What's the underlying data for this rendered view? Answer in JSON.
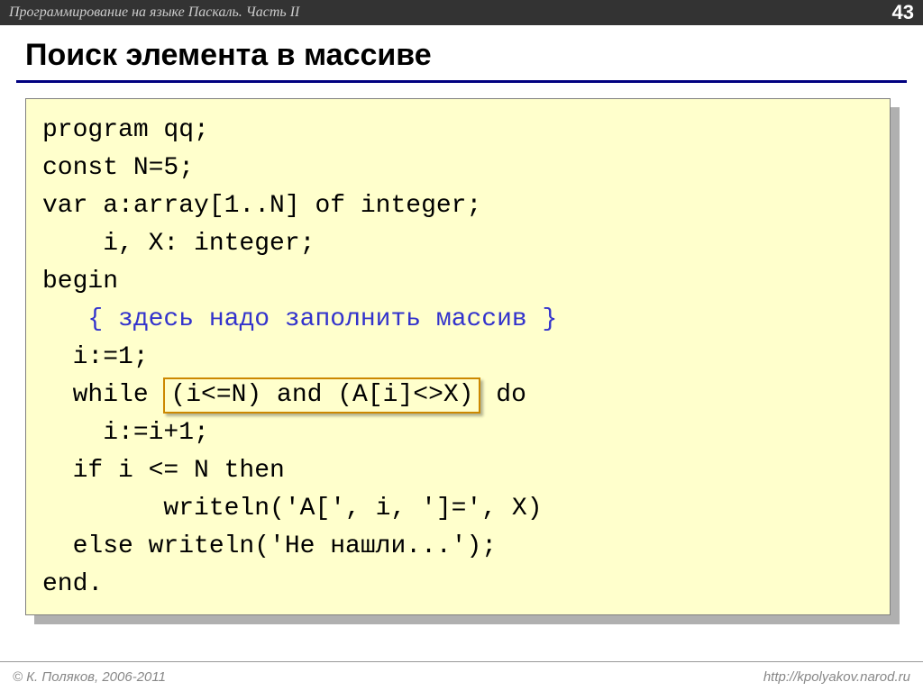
{
  "header": {
    "course_title": "Программирование на языке Паскаль. Часть II",
    "page_number": "43"
  },
  "slide": {
    "title": "Поиск элемента в массиве"
  },
  "code": {
    "l1": "program qq;",
    "l2": "const N=5;",
    "l3": "var a:array[1..N] of integer;",
    "l4": "    i, X: integer;",
    "l5": "begin",
    "l6_indent": "   ",
    "l6_comment": "{ здесь надо заполнить массив }",
    "l7": "  i:=1;",
    "l8_before": "  while ",
    "l8_hl": "(i<=N) and (A[i]<>X)",
    "l8_after": " do",
    "l9": "    i:=i+1;",
    "l10": "  if i <= N then",
    "l11": "        writeln('A[', i, ']=', X)",
    "l12": "  else writeln('Не нашли...');",
    "l13": "end."
  },
  "footer": {
    "copyright": "© К. Поляков, 2006-2011",
    "url": "http://kpolyakov.narod.ru"
  }
}
